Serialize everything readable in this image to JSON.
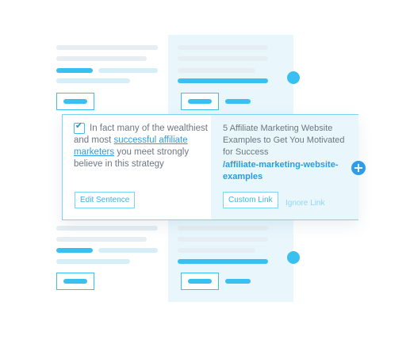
{
  "card": {
    "sentence_before": "In fact many of the wealthiest and most ",
    "sentence_link": "successful affiliate marketers",
    "sentence_after": " you meet strongly believe in this strategy",
    "edit_button": "Edit Sentence",
    "suggested_title": "5 Affiliate Marketing Website Examples to Get You Motivated for Success",
    "suggested_slug": "/affiliate-marketing-website-examples",
    "custom_link_button": "Custom Link",
    "ignore_link_button": "Ignore Link",
    "checkbox_checked": true
  },
  "icons": {
    "checkbox": "check-icon",
    "add": "plus-icon"
  },
  "colors": {
    "accent": "#39c0f0",
    "link": "#2f9ce3",
    "panel": "#e9f7fd"
  }
}
